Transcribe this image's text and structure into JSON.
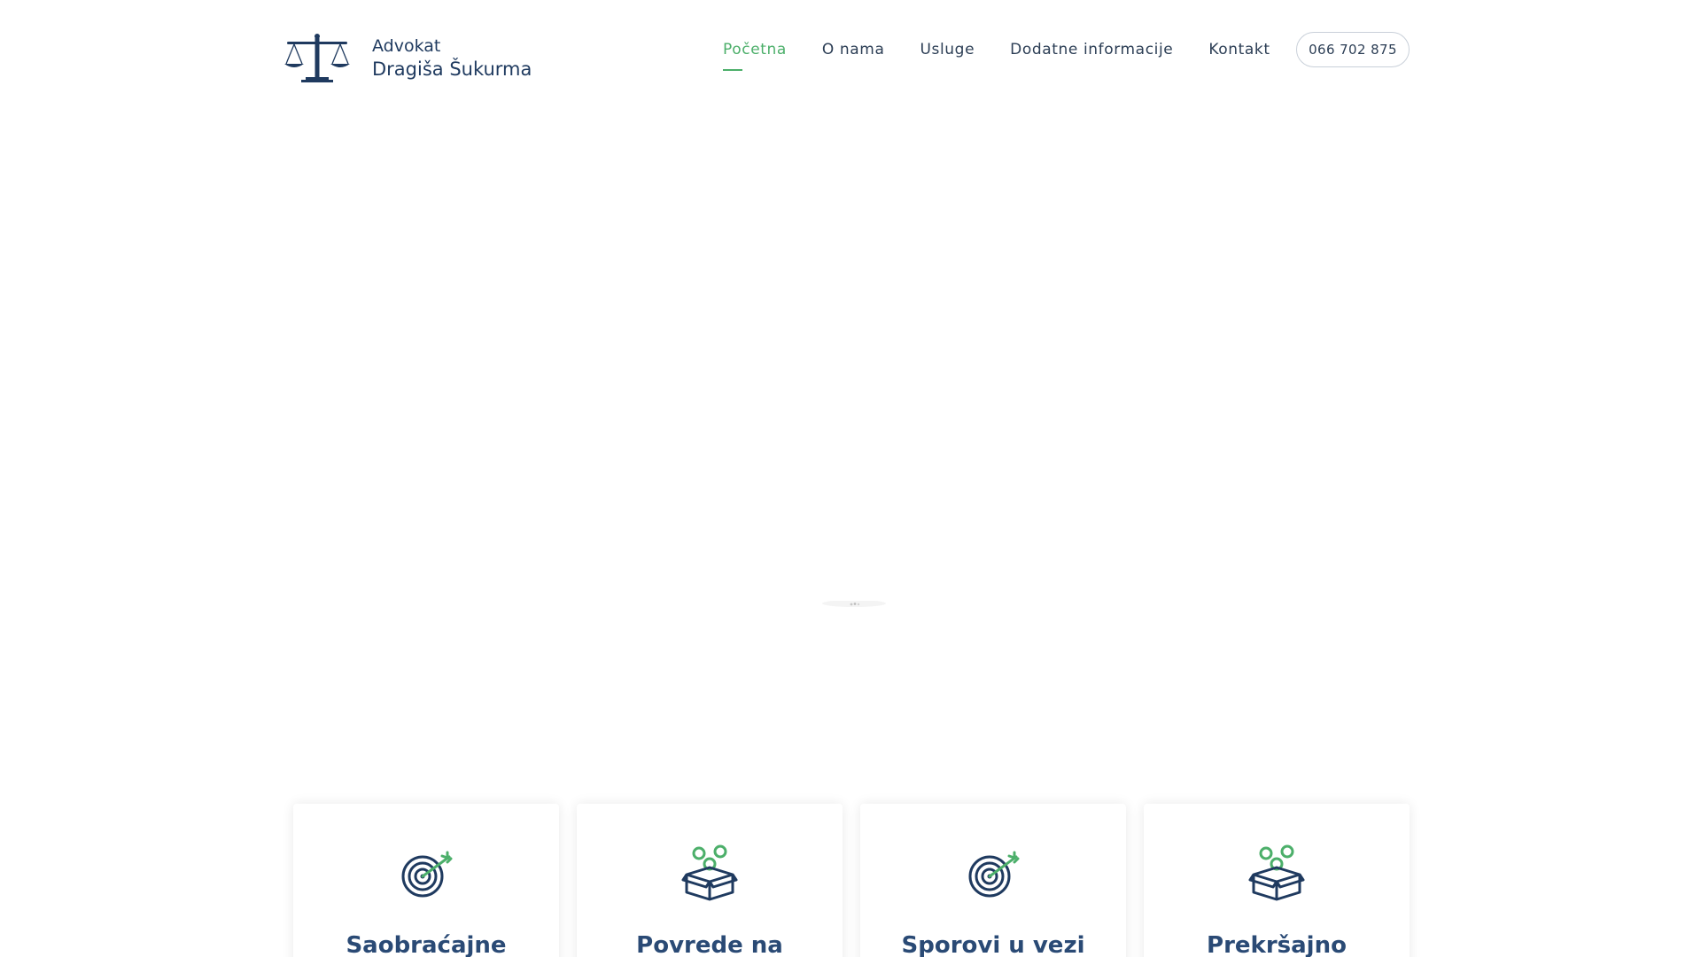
{
  "brand": {
    "line1": "Advokat",
    "line2": "Dragiša Šukurma",
    "icon": "scales-of-justice-icon",
    "color_primary": "#1f3a5f"
  },
  "nav": {
    "items": [
      {
        "label": "Početna",
        "active": true
      },
      {
        "label": "O nama",
        "active": false
      },
      {
        "label": "Usluge",
        "active": false
      },
      {
        "label": "Dodatne informacije",
        "active": false
      },
      {
        "label": "Kontakt",
        "active": false
      }
    ],
    "phone_label": "066 702 875",
    "accent_color": "#4caf6a"
  },
  "services": [
    {
      "title": "Saobraćajne",
      "icon": "target-arrow-icon"
    },
    {
      "title": "Povrede na",
      "icon": "open-box-icon"
    },
    {
      "title": "Sporovi u vezi",
      "icon": "target-arrow-icon"
    },
    {
      "title": "Prekršajno",
      "icon": "open-box-icon"
    }
  ]
}
